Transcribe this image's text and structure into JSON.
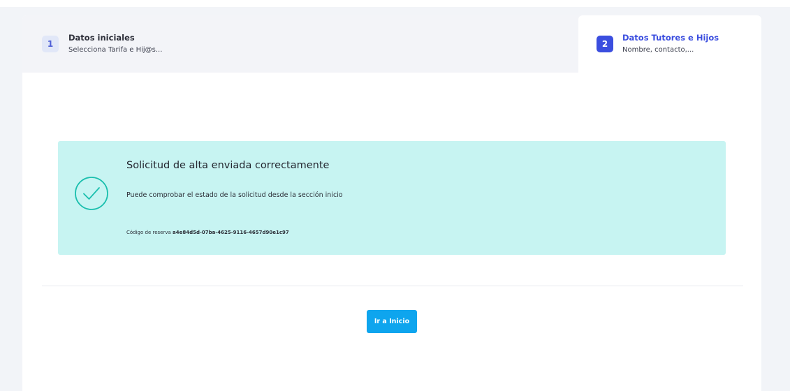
{
  "steps": [
    {
      "number": "1",
      "title": "Datos iniciales",
      "subtitle": "Selecciona Tarifa e Hij@s..."
    },
    {
      "number": "2",
      "title": "Datos Tutores e Hijos",
      "subtitle": "Nombre, contacto,..."
    }
  ],
  "alert": {
    "icon": "check-circle-icon",
    "title": "Solicitud de alta enviada correctamente",
    "message": "Puede comprobar el estado de la solicitud desde la sección inicio",
    "code_label": "Código de reserva",
    "code_value": "a4e84d5d-07ba-4625-9116-4657d90e1c97"
  },
  "actions": {
    "home_label": "Ir a Inicio"
  },
  "colors": {
    "accent": "#3b4edf",
    "success_bg": "#c7f4f2",
    "success_icon": "#1bbfae",
    "button": "#0ea5ee"
  }
}
